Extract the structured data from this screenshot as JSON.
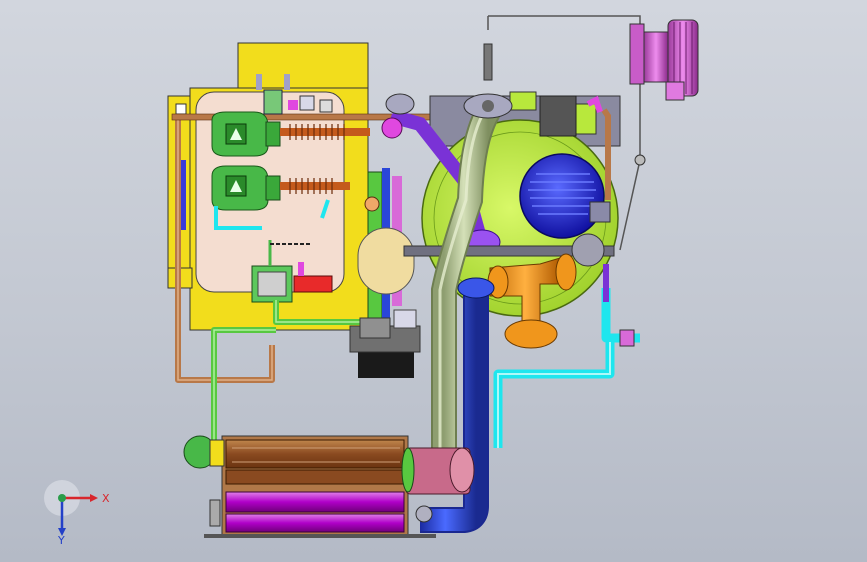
{
  "triad": {
    "x_label": "X",
    "y_label": "Y",
    "x_color": "#d8262c",
    "y_color": "#2a9d4a",
    "z_color": "#2340c8"
  },
  "palette": {
    "background": "#c8ccd5",
    "tank_yellow": "#f2dd1c",
    "tank_inner": "#f4ddd0",
    "pipe_sage": "#b9c898",
    "pipe_blue": "#2a46d8",
    "pipe_cyan": "#1ee6ee",
    "pipe_purple": "#7a32d6",
    "pipe_magenta": "#d86ad8",
    "pipe_green": "#58c840",
    "pump_green": "#48b848",
    "flywheel": "#b8e83c",
    "motor_blue": "#2a2ad8",
    "elbow_orange": "#f0961c",
    "copper": "#b87848",
    "coil_brown": "#8a4a20",
    "pulley_magenta": "#c85cc8"
  }
}
